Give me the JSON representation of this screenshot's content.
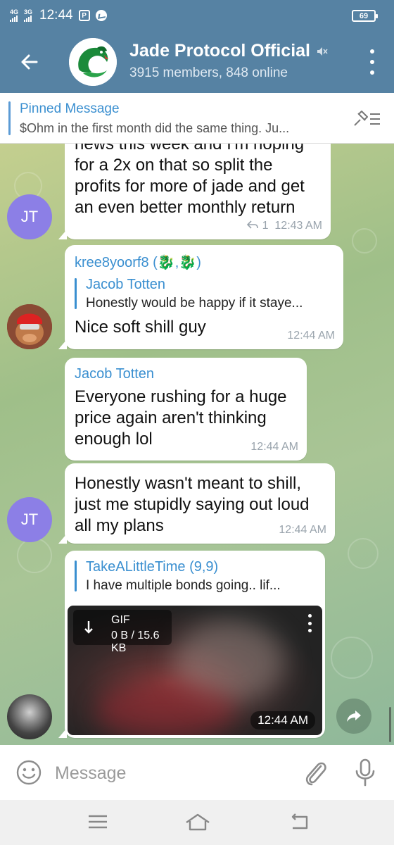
{
  "status_bar": {
    "network_1": "4G",
    "network_2": "3G",
    "time": "12:44",
    "app_badge": "P",
    "battery": "69"
  },
  "header": {
    "title": "Jade Protocol Official",
    "subtitle": "3915 members, 848 online"
  },
  "pinned": {
    "title": "Pinned Message",
    "text": "$Ohm in the first month did the same thing. Ju..."
  },
  "messages": [
    {
      "lines": [
        "news this week and I'm hoping",
        "for a 2x on that so split the",
        "profits for more of jade and get",
        "an even better monthly return"
      ],
      "reply_count": "1",
      "time": "12:43 AM",
      "avatar": "JT"
    },
    {
      "sender": "kree8yoorf8 (🐉,🐉)",
      "reply_name": "Jacob Totten",
      "reply_text": "Honestly would be happy if it staye...",
      "lines": [
        "Nice soft shill guy"
      ],
      "time": "12:44 AM"
    },
    {
      "sender": "Jacob Totten",
      "lines": [
        "Everyone rushing for a huge",
        "price again aren't thinking",
        "enough lol"
      ],
      "time": "12:44 AM"
    },
    {
      "lines": [
        "Honestly wasn't meant to shill,",
        "just me stupidly saying out loud",
        "all my plans"
      ],
      "time": "12:44 AM",
      "avatar": "JT"
    },
    {
      "sender": "TakeALittleTime (9,9)",
      "reply_text": "I have multiple bonds going.. lif...",
      "gif_label": "GIF",
      "gif_size": "0 B / 15.6 KB",
      "time": "12:44 AM"
    }
  ],
  "input": {
    "placeholder": "Message"
  },
  "colors": {
    "header": "#5682a3",
    "link": "#3a8fd0",
    "avatar_jt": "#8c7fe6"
  }
}
